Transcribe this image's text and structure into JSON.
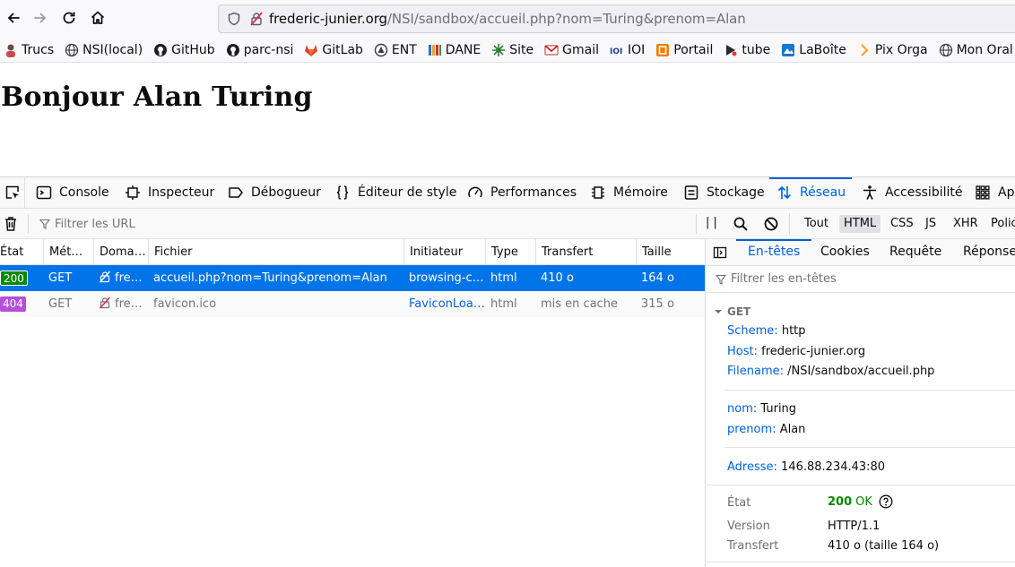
{
  "url": {
    "host": "frederic-junier.org",
    "rest": "/NSI/sandbox/accueil.php?nom=Turing&prenom=Alan"
  },
  "bookmarks": [
    {
      "label": "Trucs",
      "icon": "avatar-icon"
    },
    {
      "label": "NSI(local)",
      "icon": "globe-icon"
    },
    {
      "label": "GitHub",
      "icon": "github-icon"
    },
    {
      "label": "parc-nsi",
      "icon": "github-icon"
    },
    {
      "label": "GitLab",
      "icon": "gitlab-icon"
    },
    {
      "label": "ENT",
      "icon": "ent-icon"
    },
    {
      "label": "DANE",
      "icon": "dane-icon"
    },
    {
      "label": "Site",
      "icon": "site-icon"
    },
    {
      "label": "Gmail",
      "icon": "gmail-icon"
    },
    {
      "label": "IOI",
      "icon": "ioi-icon"
    },
    {
      "label": "Portail",
      "icon": "portail-icon"
    },
    {
      "label": "tube",
      "icon": "tube-icon"
    },
    {
      "label": "LaBoîte",
      "icon": "laboite-icon"
    },
    {
      "label": "Pix Orga",
      "icon": "pix-icon"
    },
    {
      "label": "Mon Oral",
      "icon": "globe-icon"
    }
  ],
  "page": {
    "heading": "Bonjour Alan Turing"
  },
  "devtools": {
    "tabs": [
      "Console",
      "Inspecteur",
      "Débogueur",
      "Éditeur de style",
      "Performances",
      "Mémoire",
      "Stockage",
      "Réseau",
      "Accessibilité",
      "Ap"
    ],
    "active_tab": "Réseau",
    "filter_placeholder": "Filtrer les URL",
    "pause_glyph": "| |",
    "type_filters": [
      "Tout",
      "HTML",
      "CSS",
      "JS",
      "XHR",
      "Polic"
    ],
    "active_type": "HTML",
    "columns": [
      "État",
      "Mét…",
      "Doma…",
      "Fichier",
      "Initiateur",
      "Type",
      "Transfert",
      "Taille"
    ],
    "requests": [
      {
        "status": "200",
        "method": "GET",
        "domain": "fre…",
        "file": "accueil.php?nom=Turing&prenom=Alan",
        "initiator": "browsing-c…",
        "type": "html",
        "transfer": "410 o",
        "size": "164 o"
      },
      {
        "status": "404",
        "method": "GET",
        "domain": "fre…",
        "file": "favicon.ico",
        "initiator": "FaviconLoa…",
        "type": "html",
        "transfer": "mis en cache",
        "size": "315 o"
      }
    ],
    "details": {
      "tabs": [
        "En-têtes",
        "Cookies",
        "Requête",
        "Réponse"
      ],
      "active_tab": "En-têtes",
      "filter_placeholder": "Filtrer les en-têtes",
      "section": "GET",
      "scheme_key": "Scheme:",
      "scheme": "http",
      "host_key": "Host:",
      "host": "frederic-junier.org",
      "filename_key": "Filename:",
      "filename": "/NSI/sandbox/accueil.php",
      "param1_key": "nom:",
      "param1": "Turing",
      "param2_key": "prenom:",
      "param2": "Alan",
      "address_key": "Adresse:",
      "address": "146.88.234.43:80",
      "status_label": "État",
      "status_code": "200",
      "status_text": "OK",
      "version_label": "Version",
      "version": "HTTP/1.1",
      "transfer_label": "Transfert",
      "transfer": "410 o (taille 164 o)"
    }
  },
  "colors": {
    "accent": "#0060df",
    "selected_row": "#0074e8",
    "status_200": "#058b00",
    "status_404": "#b74edb"
  }
}
